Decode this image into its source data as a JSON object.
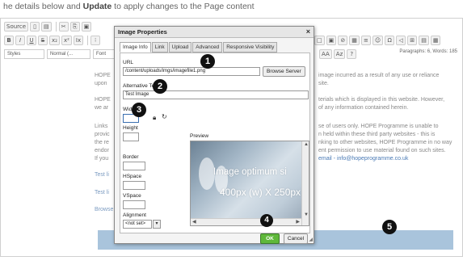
{
  "instruction": {
    "prefix": "he details below and ",
    "bold": "Update",
    "suffix": " to apply changes to the Page content"
  },
  "toolbar": {
    "row1": [
      "Source",
      "",
      "",
      "",
      "",
      "",
      ""
    ],
    "row2": [
      "B",
      "I",
      "U",
      "S",
      "x₂",
      "x²",
      "Ix",
      "",
      "⁝"
    ],
    "row3": [
      "Styles",
      "Normal (...",
      "Font"
    ],
    "right_row2": [
      "□",
      "▣",
      "⊘",
      "▦",
      "≡",
      "☺",
      "Ω",
      "◁",
      "⊞",
      "▤",
      "▦"
    ],
    "right_row3": [
      "AA",
      "Az",
      "?"
    ]
  },
  "status": "Paragraphs: 6, Words: 185",
  "content": {
    "right_lines": [
      "image incurred as a result of any use or reliance",
      "site.",
      "",
      "terials which is displayed in this website. However,",
      "of any information contained herein.",
      "",
      "se of users only. HOPE Programme is unable to",
      "n held within these third party websites - this is",
      "nking to other websites, HOPE Programme in no way",
      "ent permission to use material found on such sites.",
      "email - info@hopeprogramme.co.uk"
    ],
    "left_lines": [
      "HOPE",
      "upon",
      "",
      "HOPE",
      "we ar",
      "",
      "Links",
      "provic",
      "the re",
      "endor",
      "If you",
      "",
      "Test li",
      "",
      "Test li",
      "",
      "Browse"
    ]
  },
  "dialog": {
    "title": "Image Properties",
    "close": "×",
    "tabs": [
      "Image Info",
      "Link",
      "Upload",
      "Advanced",
      "Responsive Visibility"
    ],
    "url_label": "URL",
    "url_value": "/content/uploads/imgs/imagefile1.png",
    "browse_label": "Browse Server",
    "alt_label": "Alternative Text",
    "alt_value": "Test Image",
    "width_label": "Width",
    "width_value": "",
    "height_label": "Height",
    "height_value": "",
    "border_label": "Border",
    "hspace_label": "HSpace",
    "vspace_label": "VSpace",
    "alignment_label": "Alignment",
    "alignment_value": "<not set>",
    "preview_label": "Preview",
    "preview_line1": "Image optimum si",
    "preview_line2": "400px (w) X 250px",
    "ok_label": "OK",
    "cancel_label": "Cancel"
  },
  "markers": [
    "1",
    "2",
    "3",
    "4",
    "5"
  ]
}
